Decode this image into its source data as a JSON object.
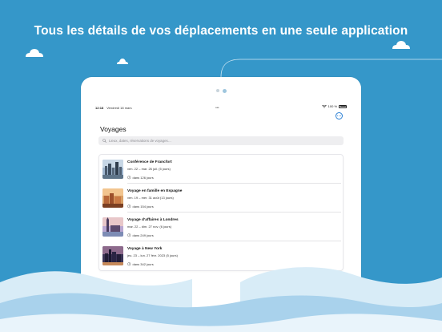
{
  "headline": "Tous les détails de vos déplacements en une seule application",
  "colors": {
    "background": "#3597c9",
    "accent": "#2a7fd4",
    "wave_light": "#d8ecf7",
    "wave_mid": "#a9d2ec"
  },
  "status_bar": {
    "time": "12:18",
    "date": "Vendredi 18 mars",
    "battery": "100 %",
    "icons": [
      "wifi-icon",
      "battery-icon"
    ]
  },
  "page": {
    "title": "Voyages",
    "more_icon": "ellipsis-circle-icon"
  },
  "search": {
    "placeholder": "Lieux, dates, réservations de voyages…",
    "icon": "search-icon"
  },
  "trips": [
    {
      "title": "Conférence de Francfort",
      "dates": "ven. 22 – mar. 26 juil. (5 jours)",
      "countdown": "dans 126 jours",
      "thumbnail": "frankfurt-skyline"
    },
    {
      "title": "Voyage en famille en Espagne",
      "dates": "ven. 19 – mer. 31 août (13 jours)",
      "countdown": "dans 154 jours",
      "thumbnail": "spain-cityscape"
    },
    {
      "title": "Voyage d’affaires à Londres",
      "dates": "mar. 22 – dim. 27 nov. (6 jours)",
      "countdown": "dans 249 jours",
      "thumbnail": "london-big-ben"
    },
    {
      "title": "Voyage à New York",
      "dates": "jeu. 23 – lun. 27 févr. 2023 (5 jours)",
      "countdown": "dans 342 jours",
      "thumbnail": "new-york-skyline"
    }
  ]
}
